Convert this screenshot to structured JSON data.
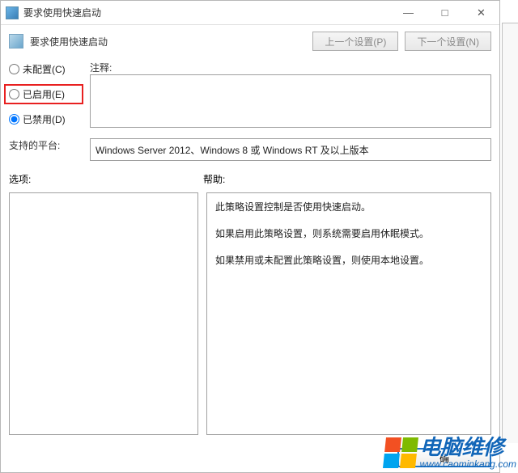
{
  "window": {
    "title": "要求使用快速启动",
    "minimize": "—",
    "maximize": "□",
    "close": "✕"
  },
  "header": {
    "title": "要求使用快速启动",
    "prev_btn": "上一个设置(P)",
    "next_btn": "下一个设置(N)"
  },
  "radios": {
    "not_configured": "未配置(C)",
    "enabled": "已启用(E)",
    "disabled": "已禁用(D)"
  },
  "labels": {
    "comment": "注释:",
    "platform": "支持的平台:",
    "options": "选项:",
    "help": "帮助:"
  },
  "platform_text": "Windows Server 2012、Windows 8 或 Windows RT 及以上版本",
  "help_paragraphs": [
    "此策略设置控制是否使用快速启动。",
    "如果启用此策略设置，则系统需要启用休眠模式。",
    "如果禁用或未配置此策略设置，则使用本地设置。"
  ],
  "footer": {
    "ok": "确"
  },
  "watermark": {
    "cn": "电脑维修",
    "url": "www.caominkang.com"
  }
}
